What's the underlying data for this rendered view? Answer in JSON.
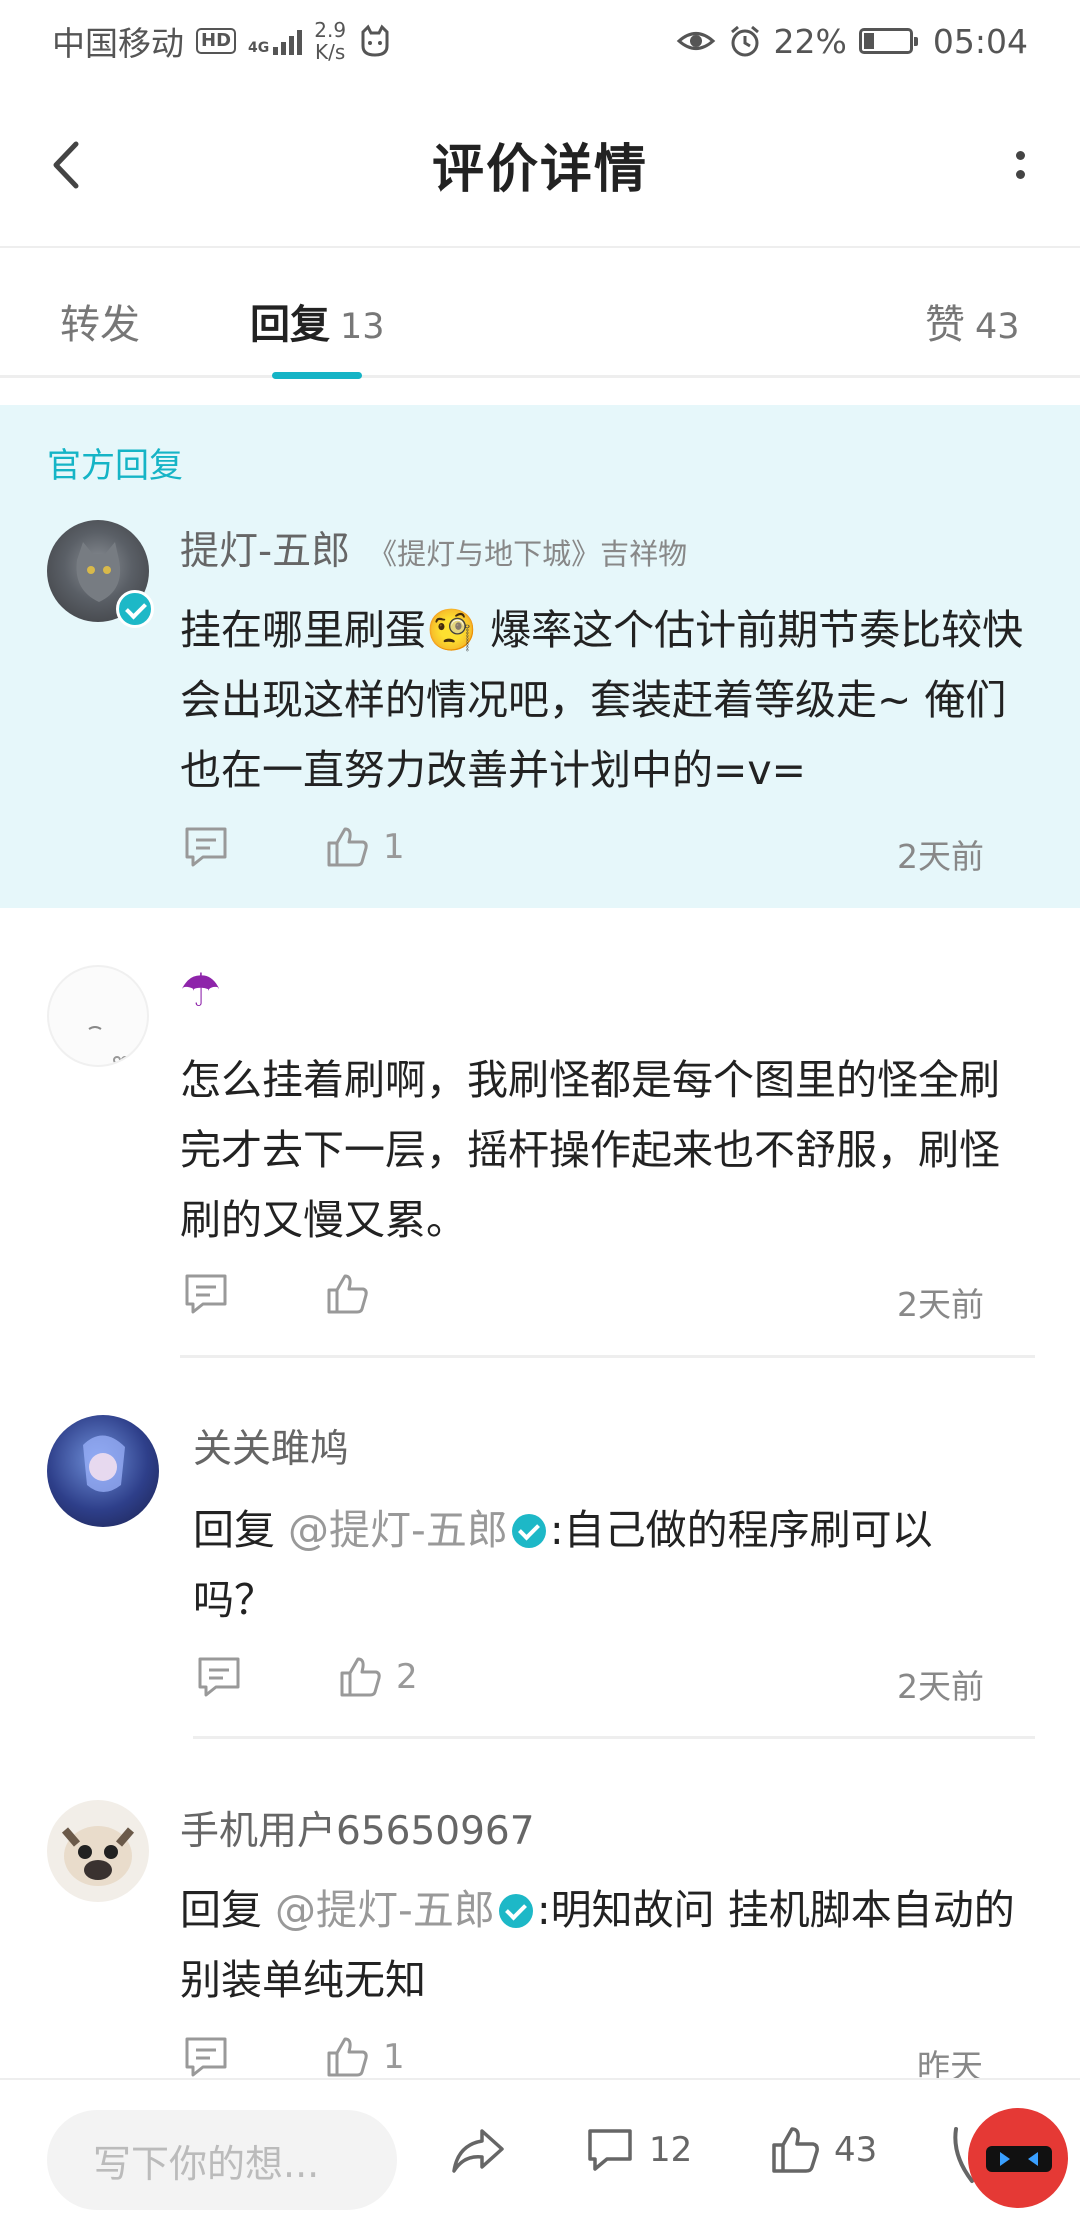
{
  "status_bar": {
    "carrier": "中国移动",
    "hd": "HD",
    "net_type": "4G",
    "speed_value": "2.9",
    "speed_unit": "K/s",
    "battery_percent": "22%",
    "battery_level": 0.22,
    "time": "05:04"
  },
  "header": {
    "title": "评价详情"
  },
  "tabs": {
    "repost_label": "转发",
    "reply_label": "回复",
    "reply_count": "13",
    "like_label": "赞",
    "like_count": "43"
  },
  "official": {
    "label": "官方回复",
    "name": "提灯-五郎",
    "tag": "《提灯与地下城》吉祥物",
    "text": "挂在哪里刷蛋🧐 爆率这个估计前期节奏比较快会出现这样的情况吧，套装赶着等级走~ 俺们也在一直努力改善并计划中的=v=",
    "likes": "1",
    "time": "2天前"
  },
  "comments": [
    {
      "name": "☂",
      "text": "怎么挂着刷啊，我刷怪都是每个图里的怪全刷完才去下一层，摇杆操作起来也不舒服，刷怪刷的又慢又累。",
      "likes": "",
      "time": "2天前"
    },
    {
      "name": "关关雎鸠",
      "reply_prefix": "回复",
      "mention": "@提灯-五郎",
      "text": ":自己做的程序刷可以吗？",
      "likes": "2",
      "time": "2天前"
    },
    {
      "name": "手机用户65650967",
      "reply_prefix": "回复",
      "mention": "@提灯-五郎",
      "text": ":明知故问 挂机脚本自动的别装单纯无知",
      "likes": "1",
      "time": "昨天"
    }
  ],
  "bottom_bar": {
    "input_placeholder": "写下你的想...",
    "comment_count": "12",
    "like_count": "43"
  }
}
